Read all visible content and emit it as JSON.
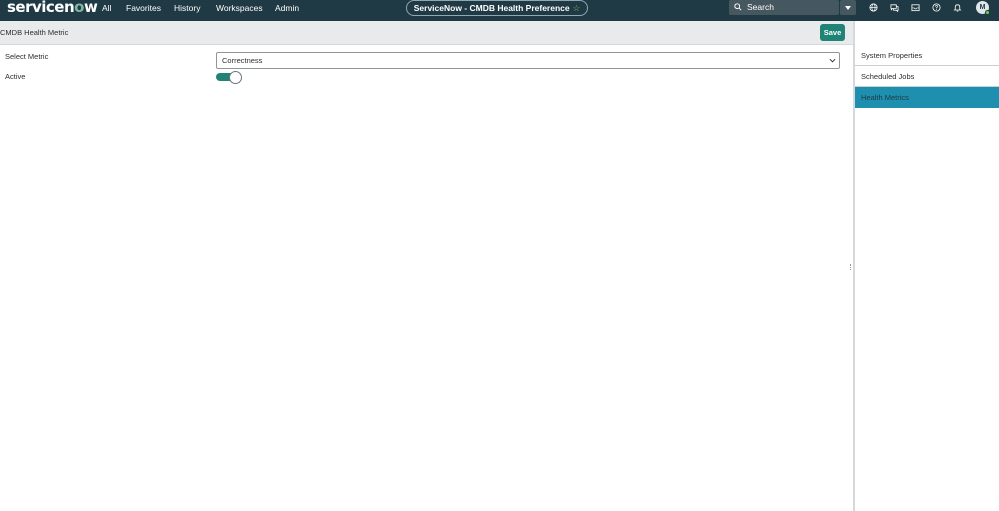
{
  "topbar": {
    "logo_text": "servicenow",
    "nav": [
      "All",
      "Favorites",
      "History",
      "Workspaces",
      "Admin"
    ],
    "page_title": "ServiceNow - CMDB Health Preference",
    "search_placeholder": "Search",
    "avatar_initial": "M",
    "icons": [
      "globe-icon",
      "chat-icon",
      "inbox-icon",
      "help-icon",
      "bell-icon"
    ]
  },
  "header": {
    "title": "CMDB Health Metric",
    "save_label": "Save"
  },
  "form": {
    "metric_label": "Select Metric",
    "metric_value": "Correctness",
    "active_label": "Active",
    "active": true
  },
  "sidebar": {
    "items": [
      {
        "label": "System Properties",
        "active": false
      },
      {
        "label": "Scheduled Jobs",
        "active": false
      },
      {
        "label": "Health Metrics",
        "active": true
      }
    ]
  },
  "colors": {
    "topbar": "#1f3a44",
    "accent": "#1f8476",
    "active_item": "#1f8fb0"
  }
}
